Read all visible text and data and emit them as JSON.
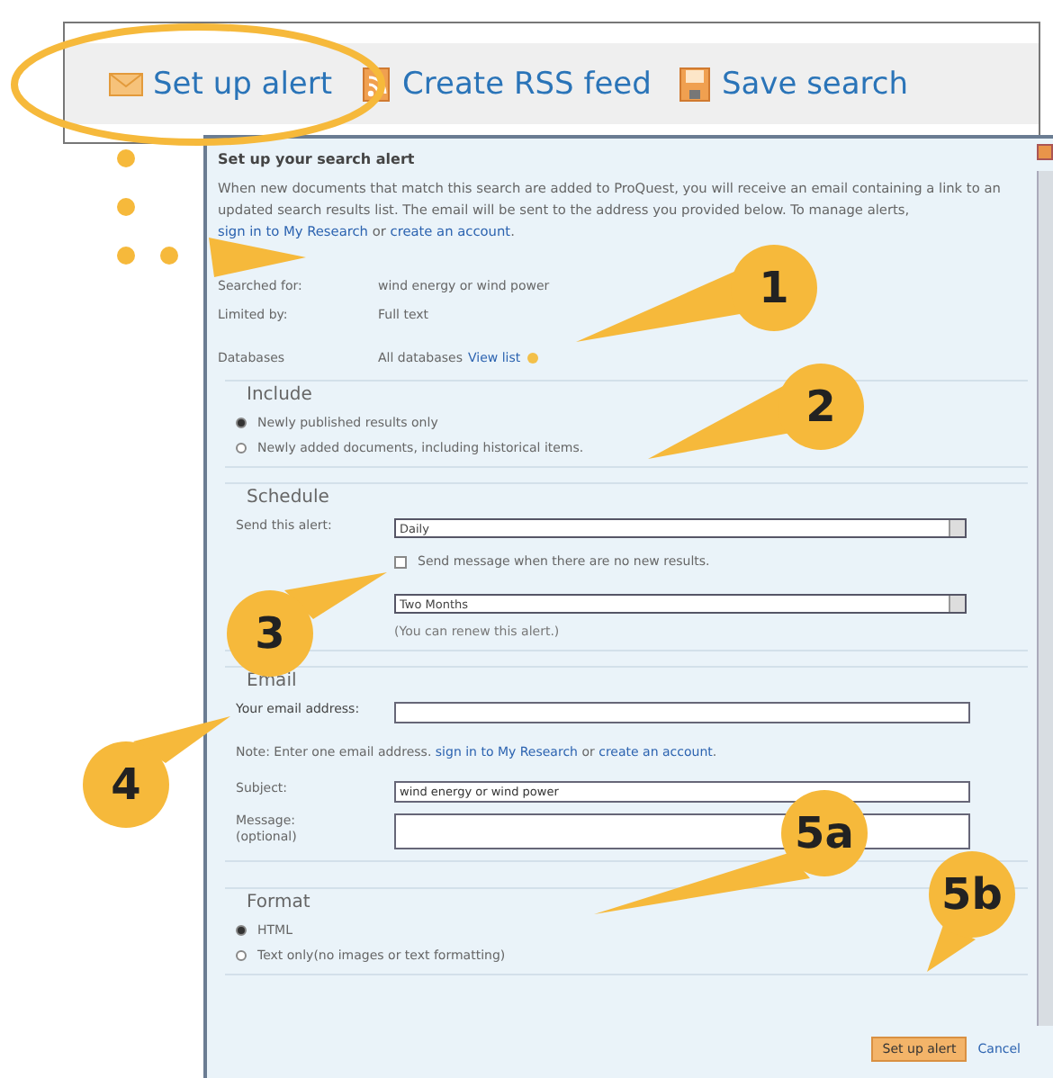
{
  "toolbar": {
    "items": [
      {
        "label": "Set up alert"
      },
      {
        "label": "Create RSS feed"
      },
      {
        "label": "Save search"
      }
    ]
  },
  "dialog": {
    "title": "Set up your search alert",
    "intro": [
      {
        "text": "When new documents that match this search are added to ProQuest, you will receive an email containing a link to an updated search results list. The email will be sent to the address you provided below. To manage alerts, ",
        "link": false
      },
      {
        "text": "sign in to My Research",
        "link": true
      },
      {
        "text": " or ",
        "link": false
      },
      {
        "text": "create an account",
        "link": true
      },
      {
        "text": ".",
        "link": false
      }
    ],
    "details": [
      {
        "label": "Searched for:",
        "value": "wind energy or wind power"
      },
      {
        "label": "Limited by:",
        "value": "Full text"
      },
      {
        "label": "Databases",
        "value": "All databases",
        "link": "View list"
      }
    ],
    "include": {
      "legend": "Include",
      "options": [
        {
          "label": "Newly published results only",
          "selected": true
        },
        {
          "label": "Newly added documents, including historical items.",
          "selected": false
        }
      ]
    },
    "schedule": {
      "legend": "Schedule",
      "send_label": "Send this alert:",
      "frequency": "Daily",
      "no_results": {
        "label": "Send message when there are no new results.",
        "checked": false
      },
      "duration": "Two Months",
      "duration_note": "(You can renew this alert.)"
    },
    "email": {
      "legend": "Email",
      "address_label": "Your email address:",
      "note": [
        {
          "text": "Note: Enter one email address. ",
          "link": false
        },
        {
          "text": "sign in to My Research",
          "link": true
        },
        {
          "text": " or ",
          "link": false
        },
        {
          "text": "create an account",
          "link": true
        },
        {
          "text": ".",
          "link": false
        }
      ],
      "subject_label": "Subject:",
      "subject": "wind energy or wind power",
      "message_label": "Message:\n(optional)"
    },
    "format": {
      "legend": "Format",
      "options": [
        {
          "label": "HTML",
          "selected": true
        },
        {
          "label": "Text only(no images or text formatting)",
          "selected": false
        }
      ]
    },
    "buttons": {
      "submit": "Set up alert",
      "cancel": "Cancel"
    }
  },
  "callouts": [
    {
      "label": "1"
    },
    {
      "label": "2"
    },
    {
      "label": "3"
    },
    {
      "label": "4"
    },
    {
      "label": "5a"
    },
    {
      "label": "5b"
    }
  ]
}
